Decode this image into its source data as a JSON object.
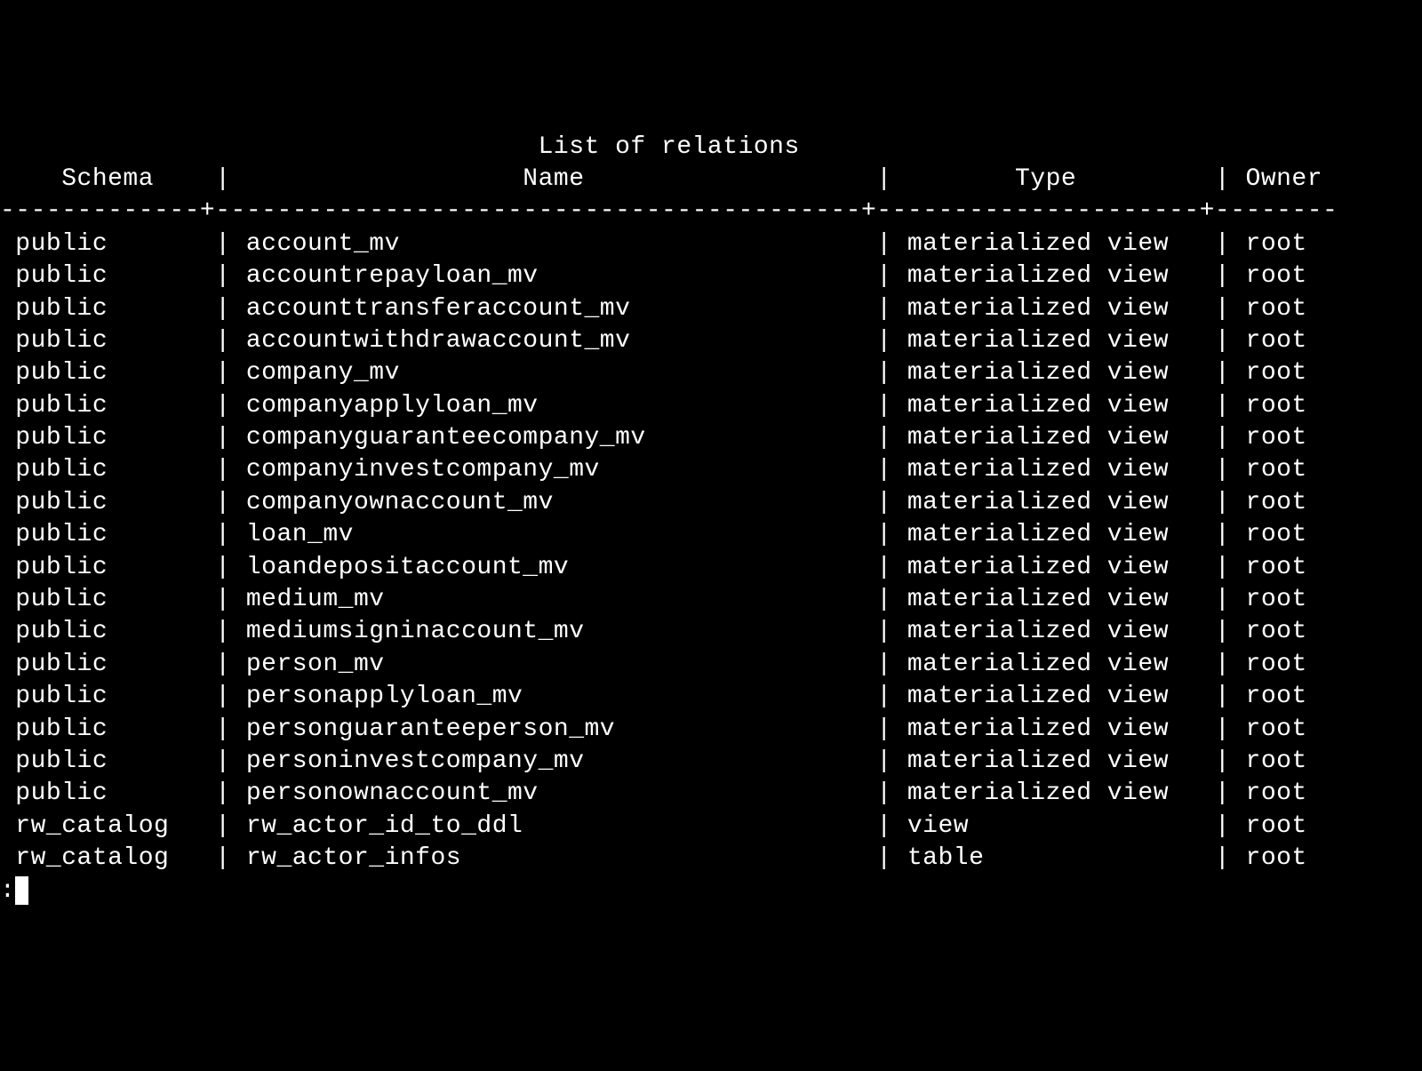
{
  "title": "List of relations",
  "columns": [
    "Schema",
    "Name",
    "Type",
    "Owner"
  ],
  "rows": [
    {
      "schema": "public",
      "name": "account_mv",
      "type": "materialized view",
      "owner": "root"
    },
    {
      "schema": "public",
      "name": "accountrepayloan_mv",
      "type": "materialized view",
      "owner": "root"
    },
    {
      "schema": "public",
      "name": "accounttransferaccount_mv",
      "type": "materialized view",
      "owner": "root"
    },
    {
      "schema": "public",
      "name": "accountwithdrawaccount_mv",
      "type": "materialized view",
      "owner": "root"
    },
    {
      "schema": "public",
      "name": "company_mv",
      "type": "materialized view",
      "owner": "root"
    },
    {
      "schema": "public",
      "name": "companyapplyloan_mv",
      "type": "materialized view",
      "owner": "root"
    },
    {
      "schema": "public",
      "name": "companyguaranteecompany_mv",
      "type": "materialized view",
      "owner": "root"
    },
    {
      "schema": "public",
      "name": "companyinvestcompany_mv",
      "type": "materialized view",
      "owner": "root"
    },
    {
      "schema": "public",
      "name": "companyownaccount_mv",
      "type": "materialized view",
      "owner": "root"
    },
    {
      "schema": "public",
      "name": "loan_mv",
      "type": "materialized view",
      "owner": "root"
    },
    {
      "schema": "public",
      "name": "loandepositaccount_mv",
      "type": "materialized view",
      "owner": "root"
    },
    {
      "schema": "public",
      "name": "medium_mv",
      "type": "materialized view",
      "owner": "root"
    },
    {
      "schema": "public",
      "name": "mediumsigninaccount_mv",
      "type": "materialized view",
      "owner": "root"
    },
    {
      "schema": "public",
      "name": "person_mv",
      "type": "materialized view",
      "owner": "root"
    },
    {
      "schema": "public",
      "name": "personapplyloan_mv",
      "type": "materialized view",
      "owner": "root"
    },
    {
      "schema": "public",
      "name": "personguaranteeperson_mv",
      "type": "materialized view",
      "owner": "root"
    },
    {
      "schema": "public",
      "name": "personinvestcompany_mv",
      "type": "materialized view",
      "owner": "root"
    },
    {
      "schema": "public",
      "name": "personownaccount_mv",
      "type": "materialized view",
      "owner": "root"
    },
    {
      "schema": "rw_catalog",
      "name": "rw_actor_id_to_ddl",
      "type": "view",
      "owner": "root"
    },
    {
      "schema": "rw_catalog",
      "name": "rw_actor_infos",
      "type": "table",
      "owner": "root"
    }
  ],
  "prompt": ":",
  "widths": {
    "schema": 12,
    "name": 40,
    "type": 19,
    "owner": 7
  }
}
